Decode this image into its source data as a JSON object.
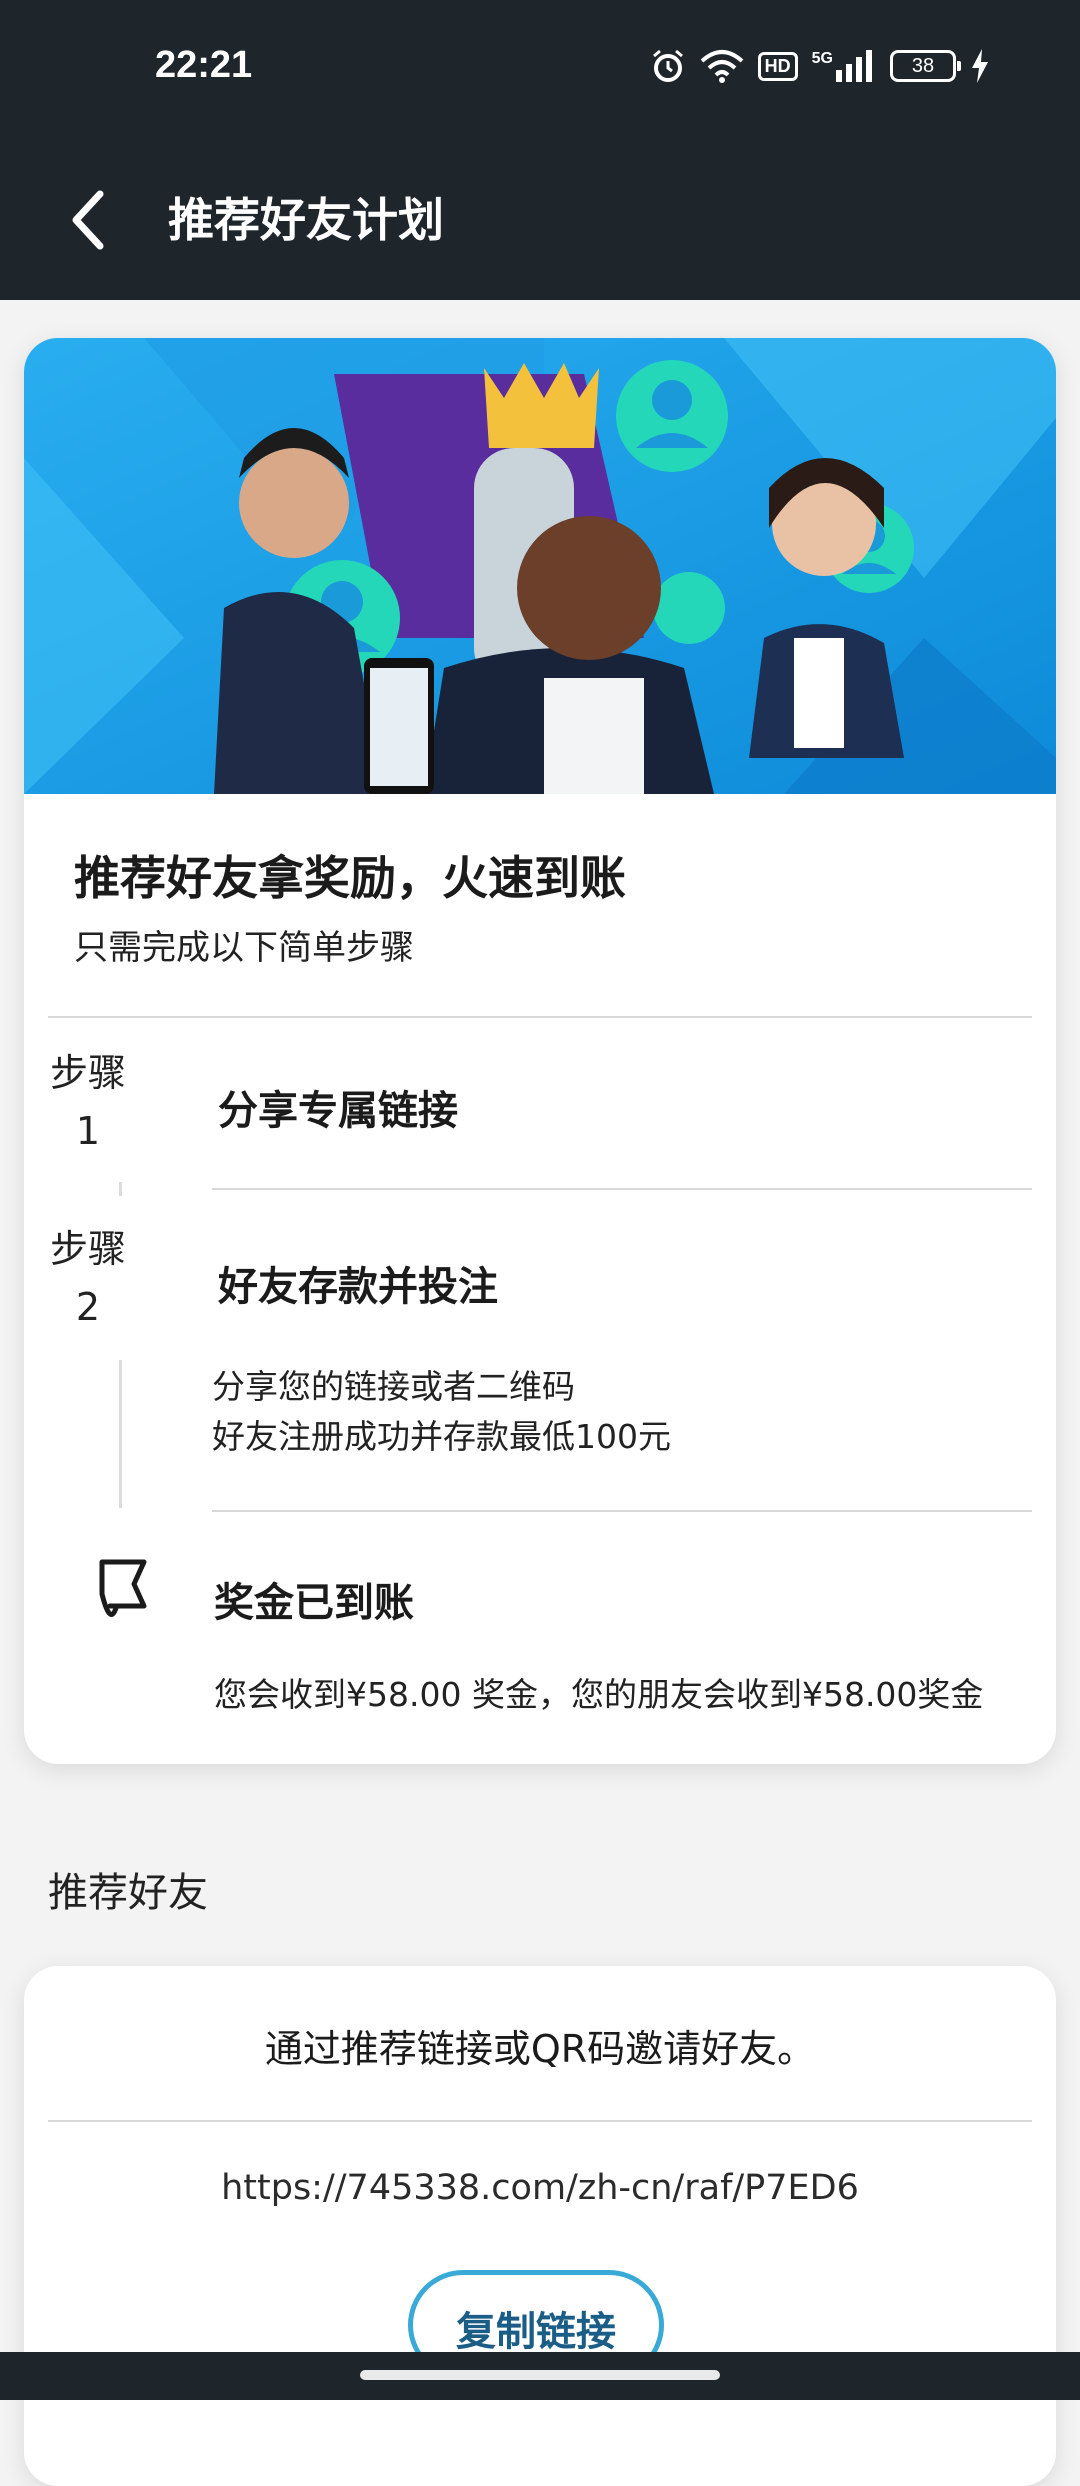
{
  "status_bar": {
    "time": "22:21",
    "network_label": "HD",
    "signal_label": "5G",
    "battery": "38",
    "icons": [
      "alarm-icon",
      "wifi-icon",
      "hd-icon",
      "signal-icon",
      "battery-icon",
      "charging-icon"
    ]
  },
  "header": {
    "title": "推荐好友计划",
    "back_icon": "chevron-left-icon"
  },
  "promo": {
    "headline": "推荐好友拿奖励，火速到账",
    "subline": "只需完成以下简单步骤",
    "steps": [
      {
        "label": "步骤",
        "number": "1",
        "title": "分享专属链接"
      },
      {
        "label": "步骤",
        "number": "2",
        "title": "好友存款并投注",
        "desc_lines": [
          "分享您的链接或者二维码",
          "好友注册成功并存款最低100元"
        ]
      }
    ],
    "reward": {
      "icon": "flag-icon",
      "title": "奖金已到账",
      "desc": "您会收到¥58.00 奖金，您的朋友会收到¥58.00奖金"
    }
  },
  "referral": {
    "section_title": "推荐好友",
    "invite_text": "通过推荐链接或QR码邀请好友。",
    "link": "https://745338.com/zh-cn/raf/P7ED6",
    "copy_button": "复制链接"
  },
  "colors": {
    "header_bg": "#1e252b",
    "banner_blue": "#1aa3e8",
    "accent_teal": "#21d6b6",
    "button_border": "#39a9d7",
    "button_text": "#1a5d86"
  }
}
